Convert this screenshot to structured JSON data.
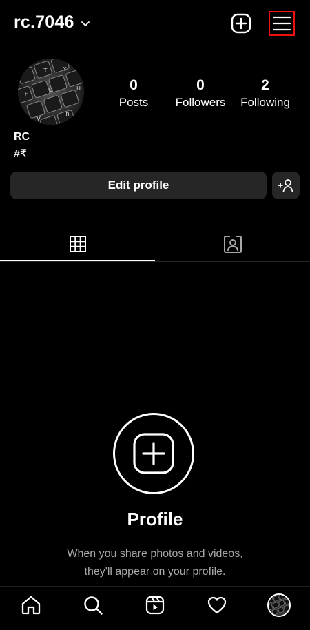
{
  "header": {
    "username": "rc.7046",
    "icons": {
      "dropdown": "chevron-down-icon",
      "create": "plus-square-icon",
      "menu": "hamburger-menu-icon"
    }
  },
  "profile": {
    "avatar_keys": [
      "T",
      "Y",
      "F",
      "G",
      "H",
      "V",
      "B"
    ],
    "stats": [
      {
        "value": "0",
        "label": "Posts"
      },
      {
        "value": "0",
        "label": "Followers"
      },
      {
        "value": "2",
        "label": "Following"
      }
    ],
    "name": "RC",
    "bio": "#₹",
    "edit_profile_label": "Edit profile",
    "discover_people_icon": "add-person-icon"
  },
  "tabs": [
    {
      "name": "posts-grid",
      "icon": "grid-icon",
      "active": true
    },
    {
      "name": "tagged",
      "icon": "tagged-person-icon",
      "active": false
    }
  ],
  "empty_state": {
    "icon": "plus-square-icon",
    "title": "Profile",
    "line1": "When you share photos and videos,",
    "line2": "they'll appear on your profile."
  },
  "bottom_nav": [
    {
      "name": "home",
      "icon": "home-icon"
    },
    {
      "name": "search",
      "icon": "search-icon"
    },
    {
      "name": "reels",
      "icon": "reels-icon"
    },
    {
      "name": "activity",
      "icon": "heart-icon"
    },
    {
      "name": "profile",
      "icon": "profile-avatar"
    }
  ]
}
